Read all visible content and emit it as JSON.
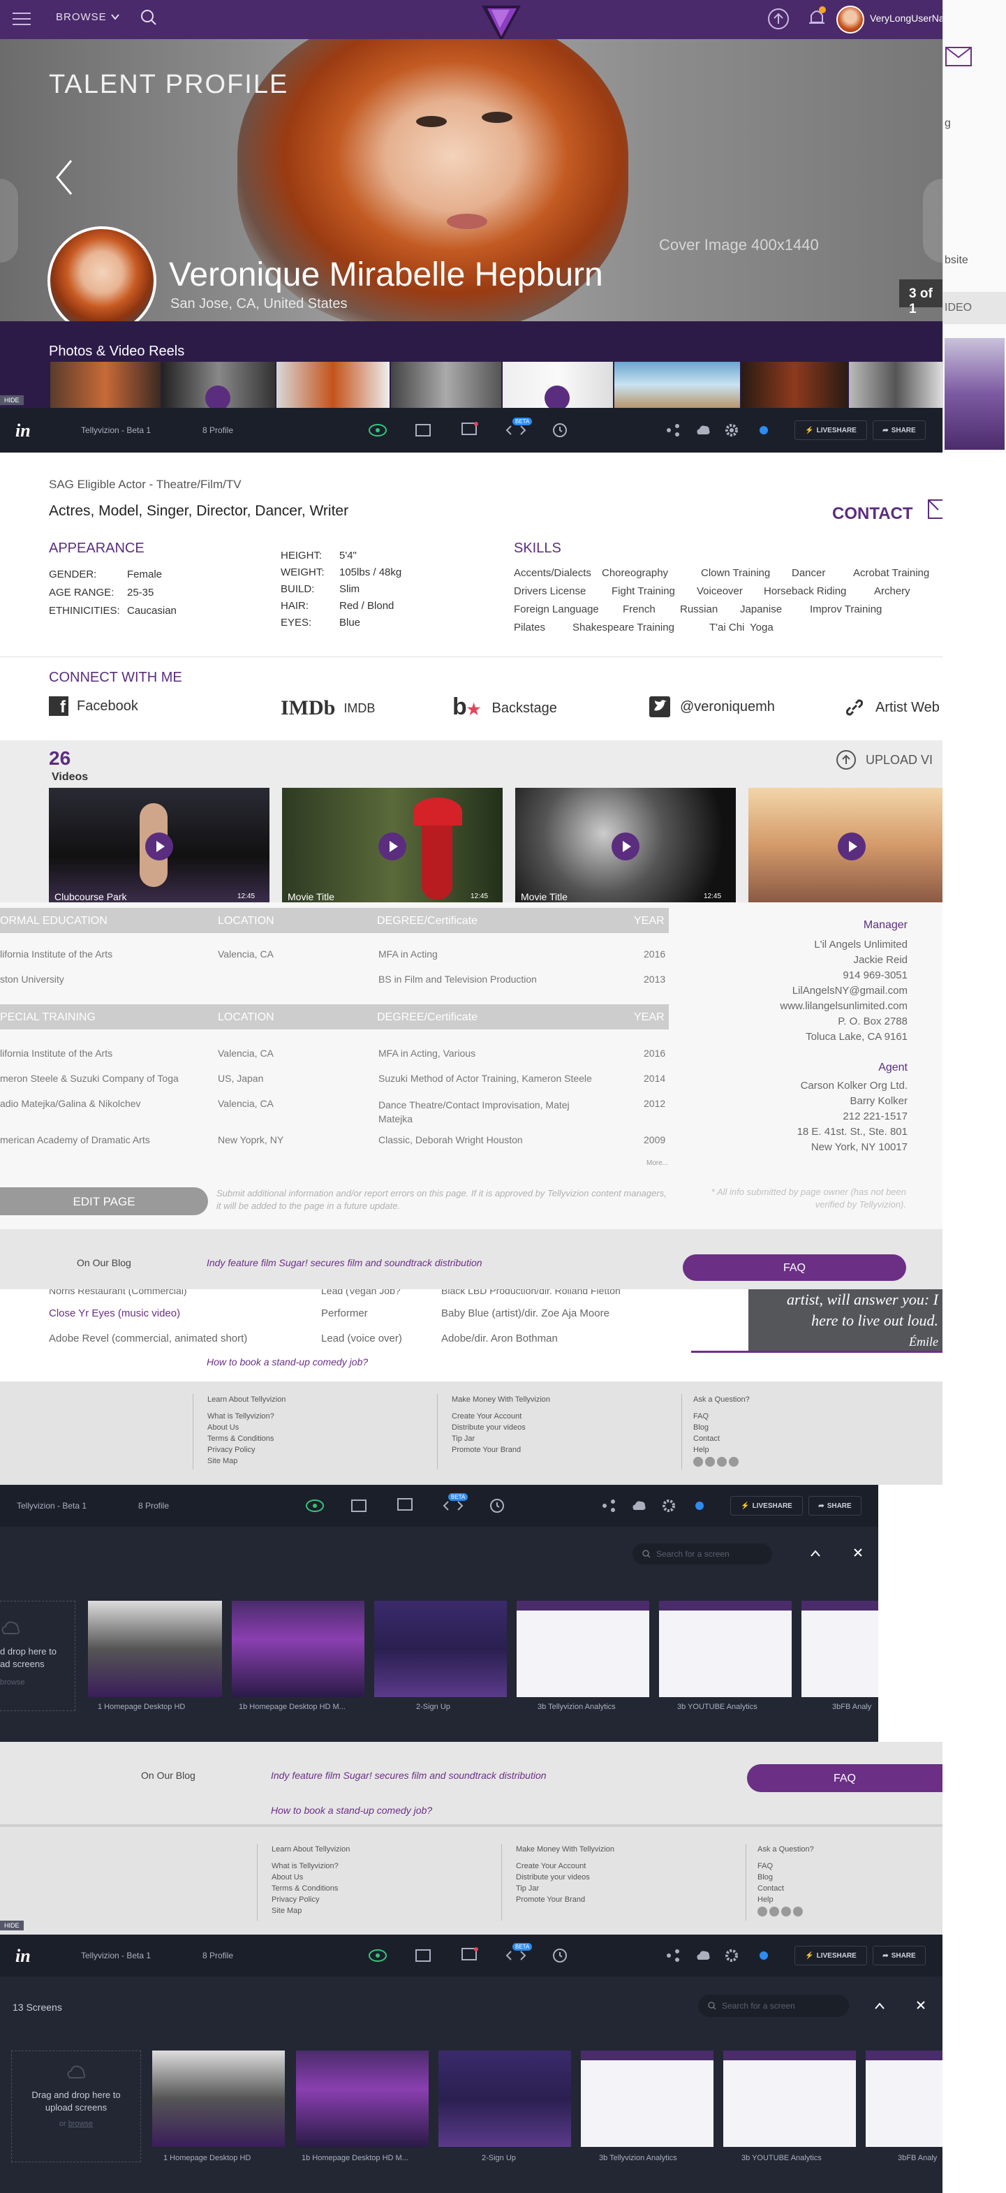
{
  "header": {
    "browse": "BROWSE",
    "username": "VeryLongUserNa"
  },
  "hero": {
    "page_title": "TALENT PROFILE",
    "name": "Veronique Mirabelle Hepburn",
    "location": "San Jose, CA, United States",
    "cover_label": "Cover Image 400x1440",
    "counter": "3 of 1",
    "photos_label": "Photos & Video Reels",
    "hide_label": "HIDE"
  },
  "side_panel": {
    "line1": "g",
    "line2": "bsite",
    "line3": "IDEO"
  },
  "invision": {
    "project": "Tellyvizion - Beta 1",
    "profile": "8 Profile",
    "beta": "BETA",
    "liveshare": "LIVESHARE",
    "share": "SHARE",
    "hide": "HIDE"
  },
  "profile": {
    "sag": "SAG Eligible Actor - Theatre/Film/TV",
    "roles": "Actres, Model, Singer, Director, Dancer, Writer",
    "contact": "CONTACT"
  },
  "appearance": {
    "heading": "APPEARANCE",
    "rows": [
      {
        "k": "GENDER:",
        "v": "Female"
      },
      {
        "k": "AGE RANGE:",
        "v": "25-35"
      },
      {
        "k": "ETHINICITIES:",
        "v": "Caucasian"
      }
    ],
    "rows2": [
      {
        "k": "HEIGHT:",
        "v": "5'4\""
      },
      {
        "k": "WEIGHT:",
        "v": "105lbs / 48kg"
      },
      {
        "k": "BUILD:",
        "v": "Slim"
      },
      {
        "k": "HAIR:",
        "v": "Red / Blond"
      },
      {
        "k": "EYES:",
        "v": "Blue"
      }
    ]
  },
  "skills": {
    "heading": "SKILLS",
    "rows": [
      [
        "Accents/Dialects",
        "Choreography",
        "Clown Training",
        "Dancer",
        "Acrobat Training"
      ],
      [
        "Drivers License",
        "Fight Training",
        "Voiceover",
        "Horseback Riding",
        "Archery"
      ],
      [
        "Foreign Language",
        "French",
        "Russian",
        "Japanise",
        "Improv Training"
      ],
      [
        "Pilates",
        "Shakespeare Training",
        "T'ai Chi",
        "Yoga"
      ]
    ]
  },
  "connect": {
    "heading": "CONNECT WITH ME",
    "facebook": "Facebook",
    "imdb_logo": "IMDb",
    "imdb": "IMDB",
    "backstage": "Backstage",
    "twitter": "@veroniquemh",
    "web": "Artist Web"
  },
  "videos": {
    "count": "26",
    "label": "Videos",
    "upload": "UPLOAD VI",
    "items": [
      {
        "title": "Clubcourse Park",
        "dur": "12:45"
      },
      {
        "title": "Movie Title",
        "dur": "12:45"
      },
      {
        "title": "Movie Title",
        "dur": "12:45"
      },
      {
        "title": "",
        "dur": ""
      }
    ]
  },
  "education": {
    "headers": [
      "ORMAL EDUCATION",
      "LOCATION",
      "DEGREE/Certificate",
      "YEAR"
    ],
    "rows": [
      [
        "lifornia Institute of the Arts",
        "Valencia, CA",
        "MFA in Acting",
        "2016"
      ],
      [
        "ston University",
        "",
        "BS in Film and Television Production",
        "2013"
      ]
    ],
    "headers2": [
      "PECIAL TRAINING",
      "LOCATION",
      "DEGREE/Certificate",
      "YEAR"
    ],
    "rows2": [
      [
        "lifornia Institute of the Arts",
        "Valencia, CA",
        "MFA in Acting, Various",
        "2016"
      ],
      [
        "meron Steele & Suzuki Company of Toga",
        "US, Japan",
        "Suzuki Method of Actor Training, Kameron Steele",
        "2014"
      ],
      [
        "adio Matejka/Galina & Nikolchev",
        "Valencia, CA",
        "Dance Theatre/Contact Improvisation, Matej Matejka",
        "2012"
      ],
      [
        "merican Academy of Dramatic Arts",
        "New Yoprk, NY",
        "Classic, Deborah Wright Houston",
        "2009"
      ]
    ],
    "more": "More..."
  },
  "reps": {
    "manager_h": "Manager",
    "manager": [
      "L'il Angels Unlimited",
      "Jackie Reid",
      "914 969-3051",
      "LilAngelsNY@gmail.com",
      "www.lilangelsunlimited.com",
      "P. O. Box 2788",
      "Toluca Lake, CA 9161"
    ],
    "agent_h": "Agent",
    "agent": [
      "Carson Kolker Org Ltd.",
      "Barry Kolker",
      "212 221-1517",
      "18 E. 41st. St., Ste. 801",
      "New York, NY 10017"
    ]
  },
  "edit": {
    "button": "EDIT PAGE",
    "note": "Submit additional information and/or report errors on this page. If it is approved by Tellyvizion content managers, it will be added to the page in a future update.",
    "disclaimer": "* All info submitted by page owner (has not been verified by Tellyvizion)."
  },
  "blog": {
    "label": "On Our Blog",
    "post1": "Indy feature film Sugar! secures film and soundtrack distribution",
    "post2": "How to book a stand-up comedy job?",
    "faq": "FAQ"
  },
  "credits": {
    "rows": [
      [
        "Norris Restaurant (Commercial)",
        "Lead (Vegan Job?",
        "Black LBD Production/dir. Rolland Fletton"
      ],
      [
        "Close Yr Eyes (music video)",
        "Performer",
        "Baby Blue (artist)/dir. Zoe Aja Moore"
      ],
      [
        "Adobe Revel (commercial, animated short)",
        "Lead (voice over)",
        "Adobe/dir. Aron Bothman"
      ]
    ],
    "quote": [
      "artist, will answer you: I",
      "here to live out loud.",
      "Émile"
    ]
  },
  "footer": {
    "col1_h": "Learn About Tellyvizion",
    "col1": [
      "What is Tellyvizion?",
      "About Us",
      "Terms & Conditions",
      "Privacy Policy",
      "Site Map"
    ],
    "col2_h": "Make Money With Tellyvizion",
    "col2": [
      "Create Your Account",
      "Distribute your videos",
      "Tip Jar",
      "Promote Your Brand"
    ],
    "col3_h": "Ask a Question?",
    "col3": [
      "FAQ",
      "Blog",
      "Contact",
      "Help"
    ]
  },
  "screens": {
    "search": "Search for a screen",
    "count": "13 Screens",
    "drop": "Drag and drop here to upload screens",
    "or": "or",
    "browse": "browse",
    "drop_short1": "d drop here to",
    "drop_short2": "ad screens",
    "items": [
      "1 Homepage Desktop HD",
      "1b Homepage Desktop HD M...",
      "2-Sign Up",
      "3b Tellyvizion Analytics",
      "3b YOUTUBE Analytics",
      "3bFB Analy"
    ]
  }
}
